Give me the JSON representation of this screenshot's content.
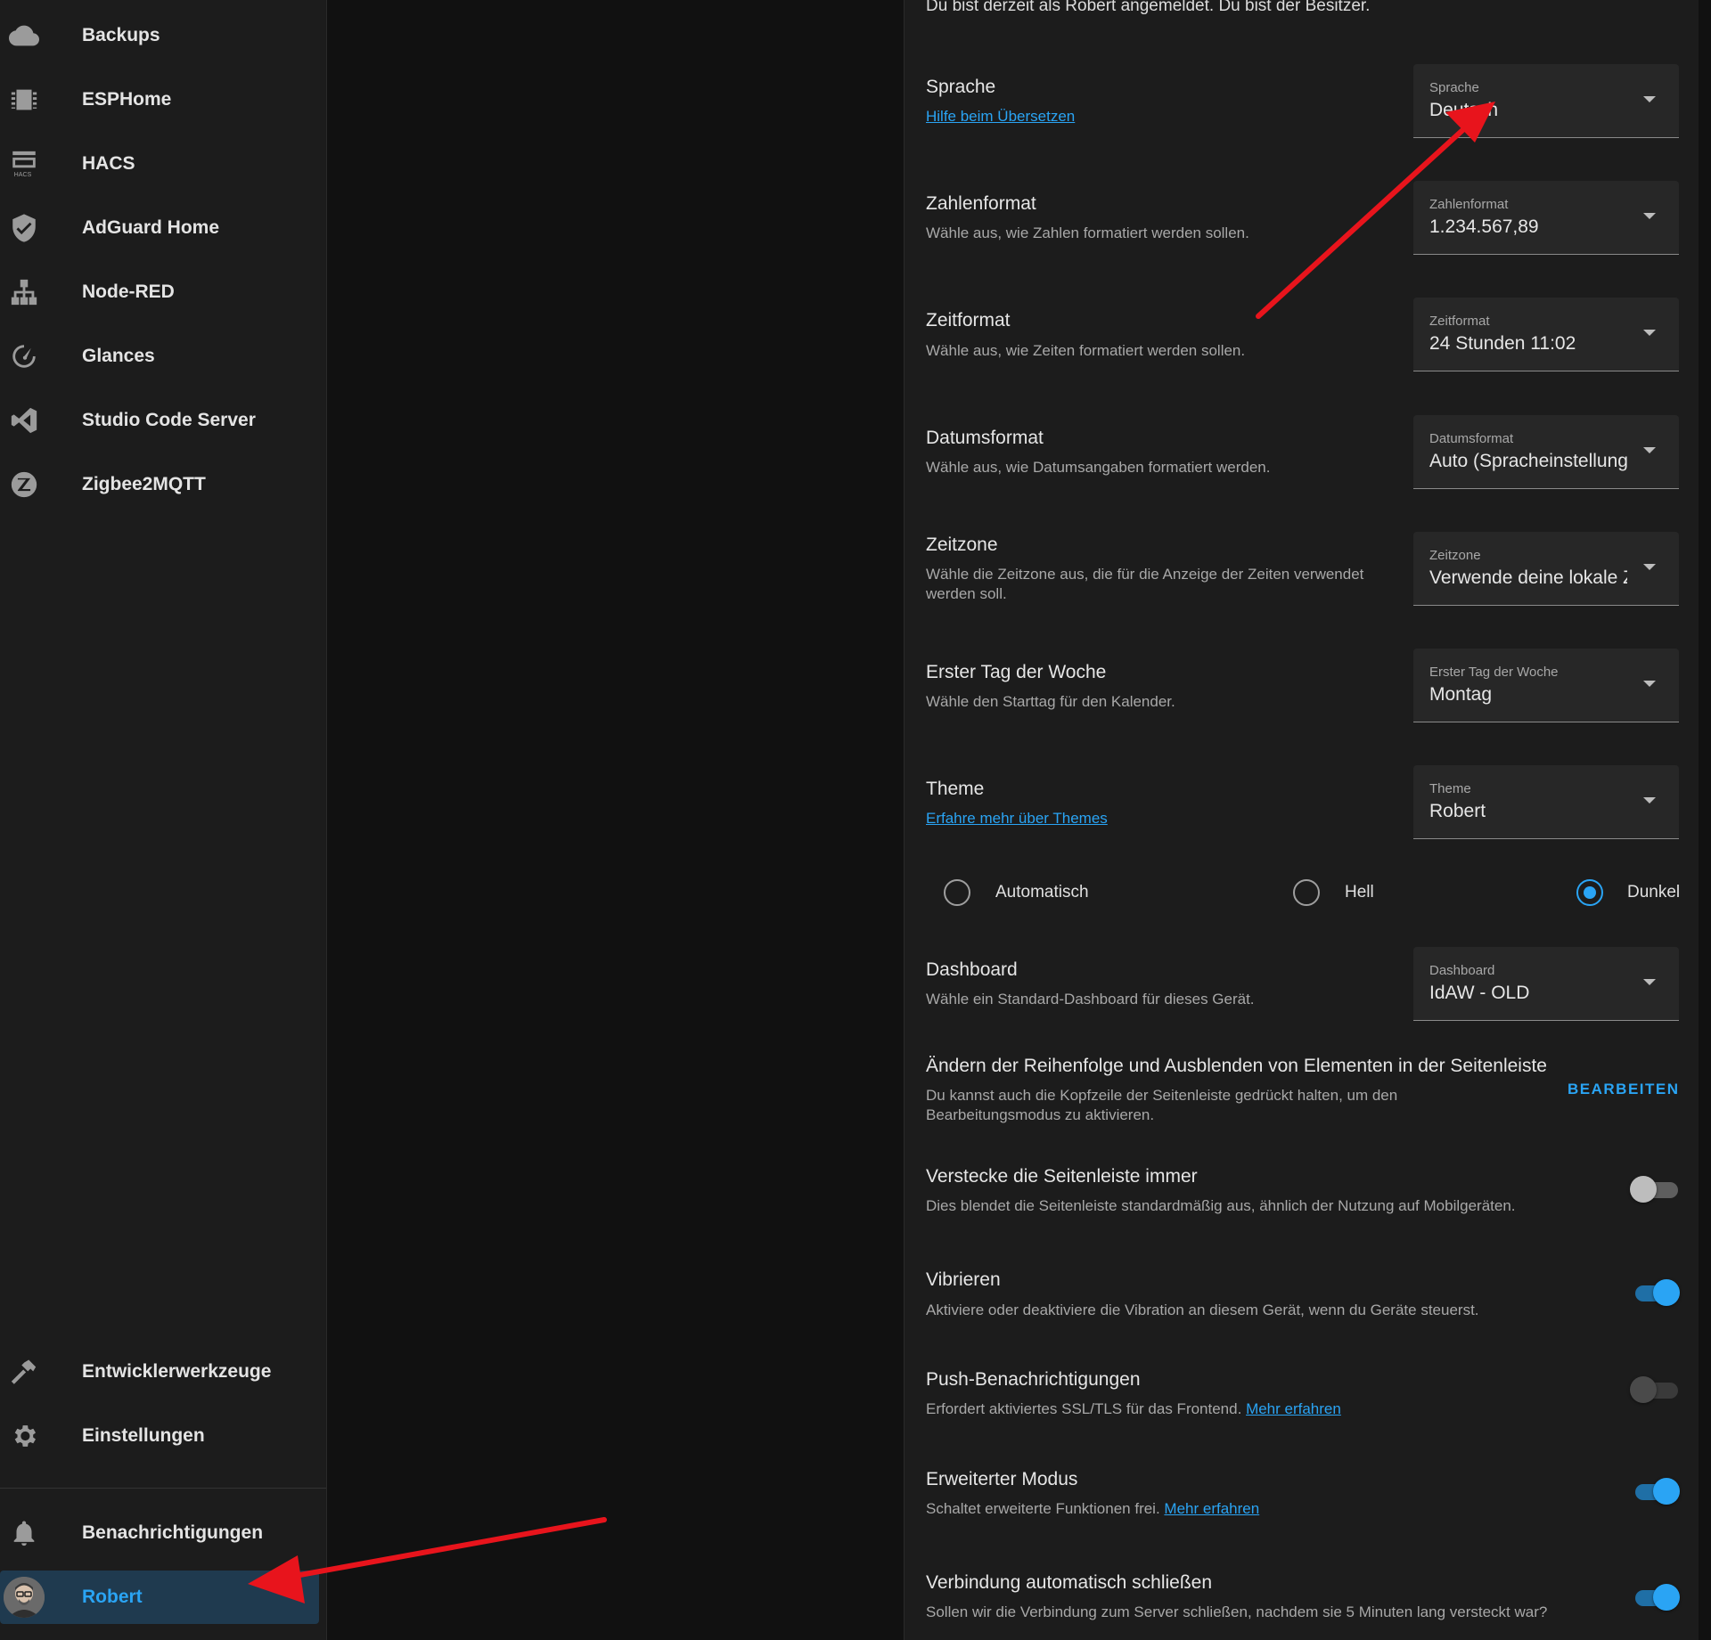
{
  "sidebar": {
    "items": [
      {
        "label": "Backups",
        "icon": "cloud-icon"
      },
      {
        "label": "ESPHome",
        "icon": "chip-icon"
      },
      {
        "label": "HACS",
        "icon": "hacs-icon"
      },
      {
        "label": "AdGuard Home",
        "icon": "shield-icon"
      },
      {
        "label": "Node-RED",
        "icon": "sitemap-icon"
      },
      {
        "label": "Glances",
        "icon": "gauge-icon"
      },
      {
        "label": "Studio Code Server",
        "icon": "vscode-icon"
      },
      {
        "label": "Zigbee2MQTT",
        "icon": "zigbee-icon"
      }
    ],
    "bottom": {
      "devtools": "Entwicklerwerkzeuge",
      "settings": "Einstellungen",
      "notifications": "Benachrichtigungen",
      "user": "Robert"
    }
  },
  "profile": {
    "intro": "Du bist derzeit als Robert angemeldet. Du bist der Besitzer.",
    "language": {
      "title": "Sprache",
      "link": "Hilfe beim Übersetzen",
      "select_label": "Sprache",
      "value": "Deutsch"
    },
    "number_format": {
      "title": "Zahlenformat",
      "desc": "Wähle aus, wie Zahlen formatiert werden sollen.",
      "select_label": "Zahlenformat",
      "value": "1.234.567,89"
    },
    "time_format": {
      "title": "Zeitformat",
      "desc": "Wähle aus, wie Zeiten formatiert werden sollen.",
      "select_label": "Zeitformat",
      "value": "24 Stunden 11:02"
    },
    "date_format": {
      "title": "Datumsformat",
      "desc": "Wähle aus, wie Datumsangaben formatiert werden.",
      "select_label": "Datumsformat",
      "value": "Auto (Spracheinstellung)"
    },
    "timezone": {
      "title": "Zeitzone",
      "desc": "Wähle die Zeitzone aus, die für die Anzeige der Zeiten verwendet werden soll.",
      "select_label": "Zeitzone",
      "value": "Verwende deine lokale Zeitzone"
    },
    "first_weekday": {
      "title": "Erster Tag der Woche",
      "desc": "Wähle den Starttag für den Kalender.",
      "select_label": "Erster Tag der Woche",
      "value": "Montag"
    },
    "theme": {
      "title": "Theme",
      "link": "Erfahre mehr über Themes",
      "select_label": "Theme",
      "value": "Robert",
      "modes": {
        "auto": "Automatisch",
        "light": "Hell",
        "dark": "Dunkel",
        "selected": "dark"
      }
    },
    "dashboard": {
      "title": "Dashboard",
      "desc": "Wähle ein Standard-Dashboard für dieses Gerät.",
      "select_label": "Dashboard",
      "value": "IdAW - OLD"
    },
    "sidebar_order": {
      "title": "Ändern der Reihenfolge und Ausblenden von Elementen in der Seitenleiste",
      "desc": "Du kannst auch die Kopfzeile der Seitenleiste gedrückt halten, um den Bearbeitungsmodus zu aktivieren.",
      "button": "BEARBEITEN"
    },
    "hide_sidebar": {
      "title": "Verstecke die Seitenleiste immer",
      "desc": "Dies blendet die Seitenleiste standardmäßig aus, ähnlich der Nutzung auf Mobilgeräten.",
      "enabled": false
    },
    "vibrate": {
      "title": "Vibrieren",
      "desc": "Aktiviere oder deaktiviere die Vibration an diesem Gerät, wenn du Geräte steuerst.",
      "enabled": true
    },
    "push": {
      "title": "Push-Benachrichtigungen",
      "desc": "Erfordert aktiviertes SSL/TLS für das Frontend.",
      "link": "Mehr erfahren",
      "enabled": false
    },
    "advanced": {
      "title": "Erweiterter Modus",
      "desc": "Schaltet erweiterte Funktionen frei.",
      "link": "Mehr erfahren",
      "enabled": true
    },
    "auto_close": {
      "title": "Verbindung automatisch schließen",
      "desc": "Sollen wir die Verbindung zum Server schließen, nachdem sie 5 Minuten lang versteckt war?",
      "enabled": true
    }
  },
  "colors": {
    "accent": "#2aa4f4",
    "annotation": "#e8141c",
    "background": "#111111",
    "panel": "#1c1c1c"
  }
}
